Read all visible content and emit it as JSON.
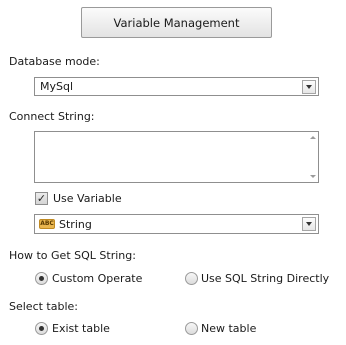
{
  "variable_button": {
    "label": "Variable Management"
  },
  "database_mode": {
    "label": "Database mode:",
    "value": "MySql"
  },
  "connect_string": {
    "label": "Connect String:",
    "value": ""
  },
  "use_variable": {
    "label": "Use Variable",
    "checked": true
  },
  "variable_type": {
    "icon_text": "ABC",
    "value": "String"
  },
  "sql_string": {
    "label": "How to Get SQL String:",
    "options": [
      "Custom Operate",
      "Use SQL String Directly"
    ],
    "selected": "Custom Operate"
  },
  "select_table": {
    "label": "Select table:",
    "options": [
      "Exist table",
      "New table"
    ],
    "selected": "Exist table"
  }
}
